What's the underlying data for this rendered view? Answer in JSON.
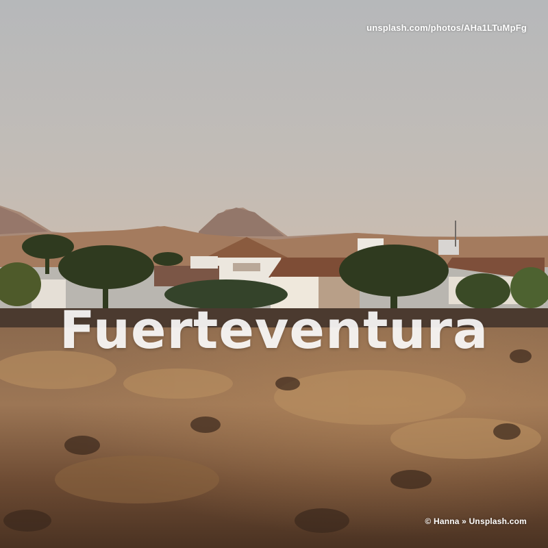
{
  "photo": {
    "title": "Fuerteventura",
    "source_url": "unsplash.com/photos/AHa1LTuMpFg",
    "credit": "© Hanna » Unsplash.com"
  },
  "colors": {
    "sky_top": "#bcbbb9",
    "sky_bottom": "#c6bcb4",
    "hills": "#a2785c",
    "ground": "#6b4a32",
    "headline_text": "#ffffff"
  }
}
